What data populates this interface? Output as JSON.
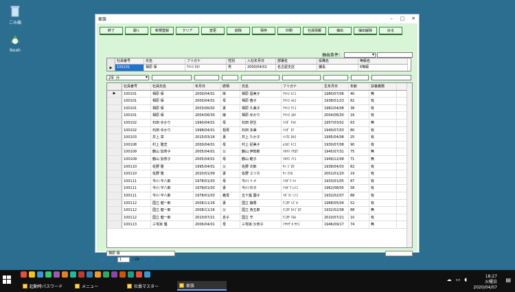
{
  "desktop": {
    "recycle_label": "ごみ箱",
    "noah_label": "Noah"
  },
  "window": {
    "title": "家族"
  },
  "toolbar": [
    "終了",
    "開く",
    "新規登録",
    "クリア",
    "変更",
    "削除",
    "保存",
    "印刷",
    "社員情報",
    "抽出",
    "抽出解除",
    "戻る"
  ],
  "filter": {
    "label": "抽出条件："
  },
  "top_grid": {
    "headers": [
      "社員番号",
      "氏名",
      "フリガナ",
      "性別",
      "入社年月日",
      "部署名",
      "役職名",
      "等級名"
    ],
    "row": [
      "100101",
      "相原 保",
      "ｱｲﾊﾗ ﾀﾓﾂ",
      "男",
      "2000/04/01",
      "名古屋支店",
      "課長",
      "6等級"
    ]
  },
  "record_selector": {
    "count": "29",
    "unit": "件"
  },
  "grid": {
    "headers": [
      "社員番号",
      "社員氏名",
      "年月日",
      "続柄",
      "氏名",
      "フリガナ",
      "生年月日",
      "年齢",
      "扶養義務"
    ],
    "rows": [
      [
        "100101",
        "相原 保",
        "2000/04/01",
        "妹",
        "相原 留美子",
        "ｱｲﾊﾗ ﾙﾐｺ",
        "1980/07/06",
        "40",
        "無"
      ],
      [
        "100101",
        "相原 保",
        "2000/04/01",
        "母",
        "相原 春子",
        "ｱｲﾊﾗ ﾊﾙｺ",
        "1938/01/23",
        "82",
        "有"
      ],
      [
        "100101",
        "相原 保",
        "2003/06/02",
        "妻",
        "相原 久美子",
        "ｱｲﾊﾗ ｸﾐｺ",
        "1982/04/08",
        "38",
        "有"
      ],
      [
        "100101",
        "相原 保",
        "2004/06/30",
        "娘",
        "相原 ゆかり",
        "ｱｲﾊﾗ ﾕｶﾘ",
        "2004/06/30",
        "16",
        "有"
      ],
      [
        "100102",
        "石田 ゆかり",
        "1990/04/01",
        "母",
        "石田 弥生",
        "ｲｼﾀﾞ ﾔﾖｲ",
        "1957/03/02",
        "63",
        "無"
      ],
      [
        "100102",
        "石田 ゆかり",
        "1998/04/01",
        "祖母",
        "石田 多美",
        "ｲｼﾀﾞ ﾀﾐ",
        "1940/07/03",
        "80",
        "有"
      ],
      [
        "100103",
        "井上 栄",
        "2015/03/16",
        "妻",
        "井上 たか子",
        "ｲﾉｳｴ ﾀｶｺ",
        "1995/04/08",
        "25",
        "有"
      ],
      [
        "100108",
        "村上 隆志",
        "2000/04/01",
        "母",
        "村上 紀美子",
        "ﾑﾗｶﾐ ｷﾐｺ",
        "1930/07/08",
        "90",
        "有"
      ],
      [
        "100109",
        "鶴山 加奈子",
        "2005/04/01",
        "父",
        "鶴山 伊知郎",
        "ﾂﾙﾔﾏ ｲﾁﾛｳ",
        "1945/07/31",
        "75",
        "無"
      ],
      [
        "100109",
        "鶴山 加奈子",
        "2005/04/01",
        "母",
        "鶴山 範子",
        "ﾂﾙﾔﾏ ﾉﾘｺ",
        "1949/12/08",
        "71",
        "無"
      ],
      [
        "100110",
        "佐野 隆",
        "1995/04/01",
        "父",
        "佐野 次郎",
        "ｻﾉ ｼﾞﾛｳ",
        "1938/04/03",
        "82",
        "有"
      ],
      [
        "100110",
        "佐野 隆",
        "2020/01/09",
        "妻",
        "佐野 エリカ",
        "ｻﾉ ｴﾘｶ",
        "2001/01/20",
        "19",
        "有"
      ],
      [
        "100111",
        "今川 平八郎",
        "1978/01/03",
        "母",
        "今川 トメ",
        "ｲﾏｶﾞﾜ ﾄﾒ",
        "1933/01/05",
        "87",
        "有"
      ],
      [
        "100111",
        "今川 平八郎",
        "1978/01/03",
        "妻",
        "今川 玲子",
        "ｲﾏｶﾞﾜ ﾚｲｺ",
        "1962/08/05",
        "58",
        "有"
      ],
      [
        "100111",
        "今川 平八郎",
        "1978/01/03",
        "義母",
        "五十嵐 園子",
        "ｲｶﾞﾗｼ ｿﾉｺ",
        "1932/02/07",
        "88",
        "有"
      ],
      [
        "100112",
        "国立 健一郎",
        "2008/11/16",
        "妻",
        "国立 静香",
        "ｸﾆﾀﾁ ｼｽﾞｶ",
        "1968/05/04",
        "52",
        "有"
      ],
      [
        "100112",
        "国立 健一郎",
        "2008/11/16",
        "父",
        "国立 為五郎",
        "ｸﾆﾀﾁ ﾀﾒｺﾞﾛｳ",
        "1932/02/08",
        "88",
        "無"
      ],
      [
        "100112",
        "国立 健一郎",
        "2010/07/21",
        "息子",
        "国立 守",
        "ｸﾆﾀﾁ ﾏﾓﾙ",
        "2010/07/21",
        "10",
        "有"
      ],
      [
        "100113",
        "三宅坂 優",
        "2006/04/01",
        "母",
        "三宅坂 沙奈子",
        "ﾐﾔｹｻﾞｶ ｻﾅｺ",
        "1946/09/17",
        "74",
        "無"
      ]
    ]
  },
  "status_text": "相原 保",
  "nav": {
    "current": "1",
    "total": "/ 29"
  },
  "taskbar": {
    "tasks": [
      "起動時パスワード",
      "メニュー",
      "社員マスター",
      "家族"
    ],
    "time": "18:27",
    "weekday": "火曜日",
    "date": "2020/04/07"
  },
  "colors": {
    "desktop": "#2b6e8f",
    "client_bg": "#d8f5d8",
    "button_border": "#3a8a3a",
    "selection": "#1e74d0"
  }
}
